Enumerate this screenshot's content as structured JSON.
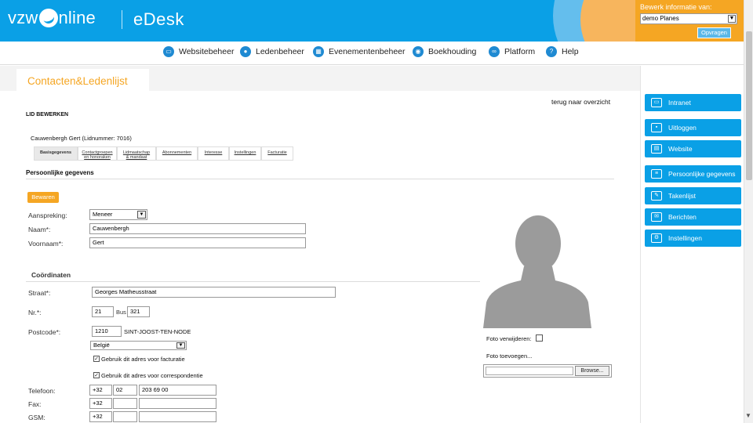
{
  "header": {
    "brand": "vzw",
    "brand_suffix": "nline",
    "app_name": "eDesk",
    "edit_label": "Bewerk informatie van:",
    "org_select": "demo Planes",
    "fetch_button": "Opvragen"
  },
  "nav": [
    {
      "label": "Websitebeheer",
      "icon": "monitor-icon"
    },
    {
      "label": "Ledenbeheer",
      "icon": "user-icon"
    },
    {
      "label": "Evenementenbeheer",
      "icon": "calendar-icon"
    },
    {
      "label": "Boekhouding",
      "icon": "coins-icon"
    },
    {
      "label": "Platform",
      "icon": "link-icon"
    },
    {
      "label": "Help",
      "icon": "help-icon"
    }
  ],
  "page_tab": "Contacten&Ledenlijst",
  "back_link": "terug naar overzicht",
  "section_title": "LID BEWERKEN",
  "member_line": "Cauwenbergh Gert (Lidnummer: 7016)",
  "subtabs": [
    {
      "label": "Basisgegevens",
      "label2": ""
    },
    {
      "label": "Contactgroepen",
      "label2": "en honoraken"
    },
    {
      "label": "Lidmaatschap",
      "label2": "& mandaat"
    },
    {
      "label": "Abonnementen",
      "label2": ""
    },
    {
      "label": "Interesse",
      "label2": ""
    },
    {
      "label": "Instellingen",
      "label2": ""
    },
    {
      "label": "Facturatie",
      "label2": ""
    }
  ],
  "personal": {
    "heading": "Persoonlijke gegevens",
    "save_button": "Bewaren",
    "salutation_label": "Aanspreking:",
    "salutation_value": "Meneer",
    "lastname_label": "Naam*:",
    "lastname_value": "Cauwenbergh",
    "firstname_label": "Voornaam*:",
    "firstname_value": "Gert"
  },
  "coords": {
    "heading": "Coördinaten",
    "street_label": "Straat*:",
    "street_value": "Georges Matheusstraat",
    "nr_label": "Nr.*:",
    "nr_value": "21",
    "bus_label": "Bus",
    "bus_value": "321",
    "postcode_label": "Postcode*:",
    "postcode_value": "1210",
    "city": "SINT-JOOST-TEN-NODE",
    "country": "België",
    "use_billing": "Gebruik dit adres voor facturatie",
    "use_correspondence": "Gebruik dit adres voor correspondentie",
    "phone_label": "Telefoon:",
    "phone": [
      "+32",
      "02",
      "203 69 00"
    ],
    "fax_label": "Fax:",
    "fax": [
      "+32",
      "",
      ""
    ],
    "gsm_label": "GSM:",
    "gsm": [
      "+32",
      "",
      ""
    ]
  },
  "photo": {
    "remove_label": "Foto verwijderen:",
    "add_label": "Foto toevoegen...",
    "browse_button": "Browse..."
  },
  "sidebar": [
    {
      "label": "Intranet",
      "icon": "monitor-lock-icon"
    },
    {
      "label": "Uitloggen",
      "icon": "lock-icon"
    },
    {
      "label": "Website",
      "icon": "website-icon"
    },
    {
      "label": "Persoonlijke gegevens",
      "icon": "id-card-icon"
    },
    {
      "label": "Takenlijst",
      "icon": "edit-icon"
    },
    {
      "label": "Berichten",
      "icon": "envelope-icon"
    },
    {
      "label": "Instellingen",
      "icon": "gear-icon"
    }
  ]
}
